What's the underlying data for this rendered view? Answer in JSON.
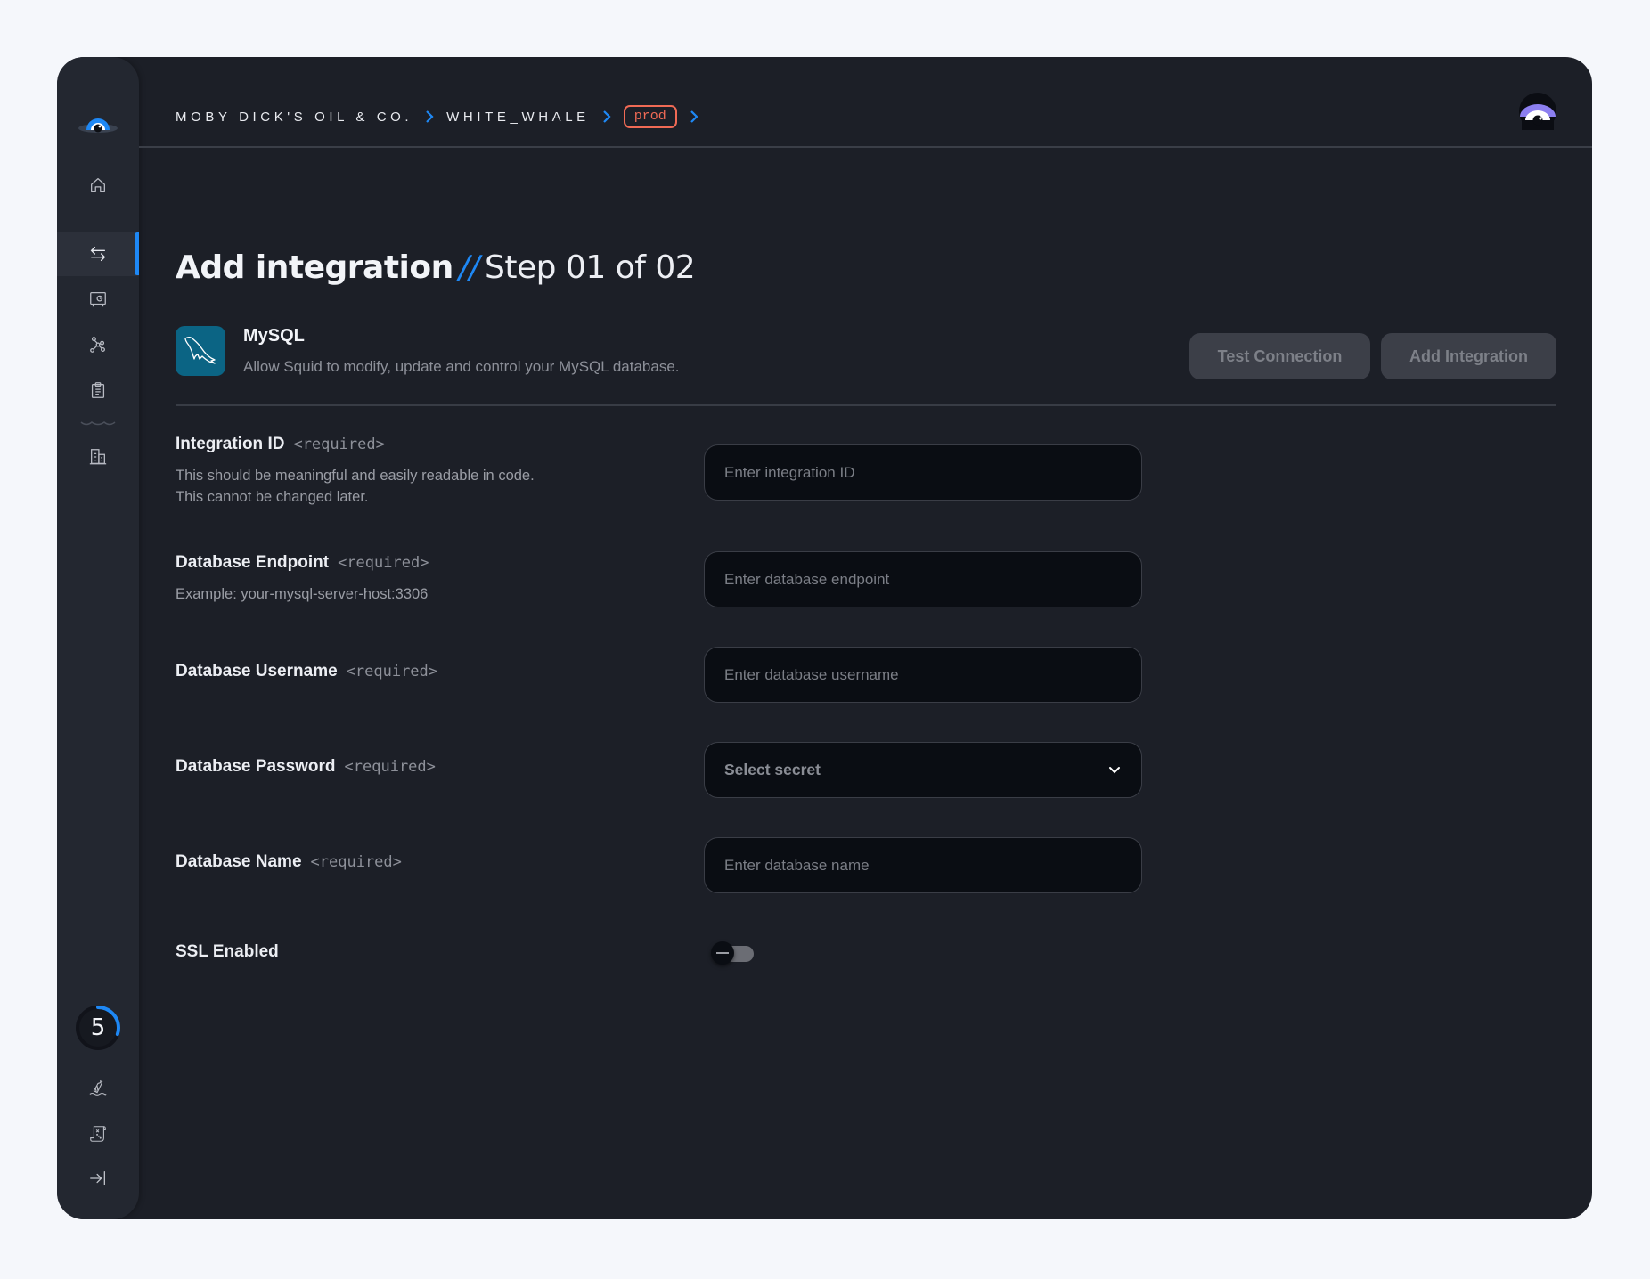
{
  "breadcrumb": {
    "org": "MOBY DICK'S OIL & CO.",
    "app": "WHITE_WHALE",
    "env": "prod"
  },
  "sidebar": {
    "items": [
      {
        "name": "home",
        "icon": "home-icon",
        "active": false
      },
      {
        "name": "integrations",
        "icon": "arrows-swap-icon",
        "active": true
      },
      {
        "name": "secrets",
        "icon": "vault-icon",
        "active": false
      },
      {
        "name": "graph",
        "icon": "network-icon",
        "active": false
      },
      {
        "name": "logs",
        "icon": "clipboard-icon",
        "active": false
      },
      {
        "name": "organization",
        "icon": "buildings-icon",
        "active": false
      }
    ],
    "bottom": {
      "counter": "5",
      "counter_progress": 0.3,
      "items": [
        {
          "name": "message-in-bottle",
          "icon": "bottle-icon"
        },
        {
          "name": "treasure-map",
          "icon": "scroll-map-icon"
        },
        {
          "name": "collapse",
          "icon": "collapse-sidebar-icon"
        }
      ]
    }
  },
  "page": {
    "title": "Add integration",
    "separator": "//",
    "step": "Step 01 of 02"
  },
  "integration": {
    "name": "MySQL",
    "description": "Allow Squid to modify, update and control your MySQL database.",
    "icon": "mysql-dolphin-icon",
    "icon_bg": "#0b6484"
  },
  "actions": {
    "test_connection": "Test Connection",
    "add_integration": "Add Integration"
  },
  "form": {
    "required_tag": "<required>",
    "fields": [
      {
        "label": "Integration ID",
        "help": [
          "This should be meaningful and easily readable in code.",
          "This cannot be changed later."
        ],
        "placeholder": "Enter integration ID",
        "value": ""
      },
      {
        "label": "Database Endpoint",
        "help": [
          "Example: your-mysql-server-host:3306"
        ],
        "placeholder": "Enter database endpoint",
        "value": ""
      },
      {
        "label": "Database Username",
        "placeholder": "Enter database username",
        "value": ""
      },
      {
        "label": "Database Password",
        "select_value": "Select secret"
      },
      {
        "label": "Database Name",
        "placeholder": "Enter database name",
        "value": ""
      }
    ],
    "ssl": {
      "label": "SSL Enabled",
      "enabled": false
    }
  },
  "colors": {
    "accent": "#1e88f5",
    "env_badge": "#f06a55",
    "background": "#1c1f27",
    "sidebar": "#232730"
  }
}
